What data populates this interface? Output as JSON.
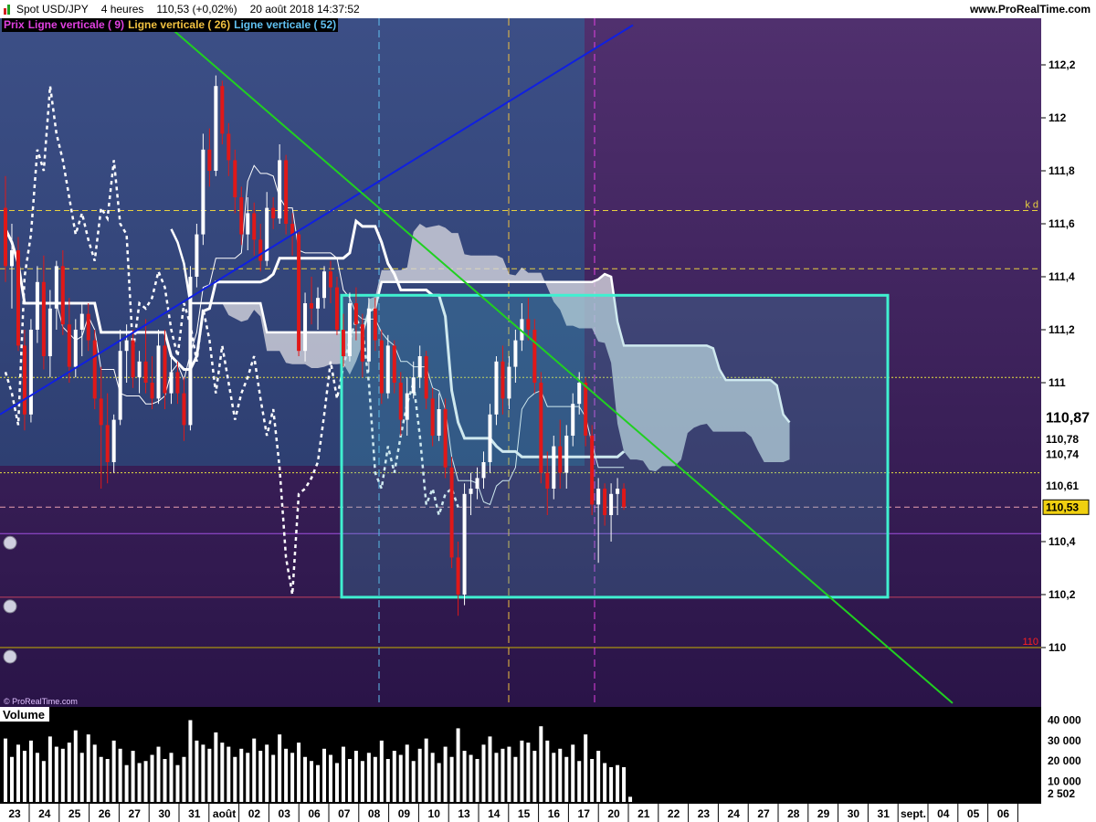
{
  "header": {
    "instrument": "Spot USD/JPY",
    "timeframe": "4 heures",
    "price_change": "110,53 (+0,02%)",
    "datetime": "20 août 2018 14:37:52",
    "site": "www.ProRealTime.com"
  },
  "legend": {
    "price_label": "Prix",
    "items": [
      {
        "label": "Ligne verticale ( 9)",
        "color": "#e040e0"
      },
      {
        "label": "Ligne verticale ( 26)",
        "color": "#f0c040"
      },
      {
        "label": "Ligne verticale ( 52)",
        "color": "#60c0f0"
      }
    ]
  },
  "watermark": "© ProRealTime.com",
  "volume_label": "Volume",
  "chart_data": {
    "type": "candlestick",
    "ylim": [
      109.8,
      112.4
    ],
    "y_ticks": [
      {
        "v": 112.2,
        "label": "112,2"
      },
      {
        "v": 112.0,
        "label": "112"
      },
      {
        "v": 111.8,
        "label": "111,8"
      },
      {
        "v": 111.6,
        "label": "111,6"
      },
      {
        "v": 111.4,
        "label": "111,4"
      },
      {
        "v": 111.2,
        "label": "111,2"
      },
      {
        "v": 111.0,
        "label": "111"
      },
      {
        "v": 110.4,
        "label": "110,4"
      },
      {
        "v": 110.2,
        "label": "110,2"
      },
      {
        "v": 110.0,
        "label": "110"
      }
    ],
    "price_tags": [
      {
        "v": 110.87,
        "label": "110,87",
        "style": "big"
      },
      {
        "v": 110.78,
        "label": "110,78",
        "style": "small"
      },
      {
        "v": 110.74,
        "label": "110,74",
        "style": "small"
      },
      {
        "v": 110.61,
        "label": "110,61",
        "style": "small"
      },
      {
        "v": 110.53,
        "label": "110,53",
        "style": "last"
      }
    ],
    "level_lines": [
      {
        "v": 111.65,
        "color": "#e8d040",
        "dash": "6,4",
        "note": "k d"
      },
      {
        "v": 111.43,
        "color": "#e8d040",
        "dash": "6,4",
        "note": ""
      },
      {
        "v": 111.02,
        "color": "#e8e040",
        "dash": "2,2",
        "note": ""
      },
      {
        "v": 110.66,
        "color": "#e8e040",
        "dash": "2,2",
        "note": ""
      },
      {
        "v": 110.53,
        "color": "#e8a0b0",
        "dash": "6,4",
        "note": ""
      },
      {
        "v": 110.43,
        "color": "#a050e0",
        "dash": "",
        "note": ""
      },
      {
        "v": 110.19,
        "color": "#c04060",
        "dash": "",
        "note": ""
      },
      {
        "v": 110.0,
        "color": "#c8b000",
        "dash": "",
        "note": "110"
      }
    ],
    "x_labels": [
      "23",
      "24",
      "25",
      "26",
      "27",
      "30",
      "31",
      "août",
      "02",
      "03",
      "06",
      "07",
      "08",
      "09",
      "10",
      "13",
      "14",
      "15",
      "16",
      "17",
      "20",
      "21",
      "22",
      "23",
      "24",
      "27",
      "28",
      "29",
      "30",
      "31",
      "sept.",
      "04",
      "05",
      "06"
    ],
    "volume_ticks": [
      {
        "v": 40000,
        "label": "40 000"
      },
      {
        "v": 30000,
        "label": "30 000"
      },
      {
        "v": 20000,
        "label": "20 000"
      },
      {
        "v": 10000,
        "label": "10 000"
      }
    ],
    "volume_last": "2 502",
    "volume_max": 42000,
    "candles": [
      {
        "o": 111.66,
        "h": 111.78,
        "l": 111.38,
        "c": 111.44
      },
      {
        "o": 111.44,
        "h": 111.6,
        "l": 111.28,
        "c": 111.5
      },
      {
        "o": 111.5,
        "h": 111.55,
        "l": 111.12,
        "c": 111.14
      },
      {
        "o": 111.14,
        "h": 111.2,
        "l": 110.82,
        "c": 110.88
      },
      {
        "o": 110.88,
        "h": 111.24,
        "l": 110.85,
        "c": 111.2
      },
      {
        "o": 111.2,
        "h": 111.44,
        "l": 111.15,
        "c": 111.38
      },
      {
        "o": 111.38,
        "h": 111.48,
        "l": 111.05,
        "c": 111.1
      },
      {
        "o": 111.1,
        "h": 111.35,
        "l": 111.02,
        "c": 111.28
      },
      {
        "o": 111.28,
        "h": 111.46,
        "l": 111.2,
        "c": 111.44
      },
      {
        "o": 111.44,
        "h": 111.5,
        "l": 111.18,
        "c": 111.22
      },
      {
        "o": 111.22,
        "h": 111.32,
        "l": 111.0,
        "c": 111.06
      },
      {
        "o": 111.06,
        "h": 111.24,
        "l": 111.02,
        "c": 111.2
      },
      {
        "o": 111.2,
        "h": 111.3,
        "l": 111.1,
        "c": 111.26
      },
      {
        "o": 111.26,
        "h": 111.3,
        "l": 111.12,
        "c": 111.16
      },
      {
        "o": 111.16,
        "h": 111.2,
        "l": 110.9,
        "c": 110.94
      },
      {
        "o": 110.94,
        "h": 111.06,
        "l": 110.6,
        "c": 110.84
      },
      {
        "o": 110.84,
        "h": 110.96,
        "l": 110.62,
        "c": 110.7
      },
      {
        "o": 110.7,
        "h": 110.88,
        "l": 110.66,
        "c": 110.86
      },
      {
        "o": 110.86,
        "h": 111.2,
        "l": 110.84,
        "c": 111.12
      },
      {
        "o": 111.12,
        "h": 111.22,
        "l": 111.0,
        "c": 111.16
      },
      {
        "o": 111.16,
        "h": 111.2,
        "l": 110.98,
        "c": 111.02
      },
      {
        "o": 111.02,
        "h": 111.12,
        "l": 110.96,
        "c": 111.08
      },
      {
        "o": 111.08,
        "h": 111.24,
        "l": 110.96,
        "c": 111.0
      },
      {
        "o": 111.0,
        "h": 111.1,
        "l": 110.9,
        "c": 110.94
      },
      {
        "o": 110.94,
        "h": 111.2,
        "l": 110.92,
        "c": 111.14
      },
      {
        "o": 111.14,
        "h": 111.2,
        "l": 110.9,
        "c": 110.96
      },
      {
        "o": 110.96,
        "h": 111.1,
        "l": 110.92,
        "c": 111.04
      },
      {
        "o": 111.04,
        "h": 111.08,
        "l": 110.92,
        "c": 110.96
      },
      {
        "o": 110.96,
        "h": 111.02,
        "l": 110.78,
        "c": 110.84
      },
      {
        "o": 110.84,
        "h": 111.44,
        "l": 110.82,
        "c": 111.4
      },
      {
        "o": 111.4,
        "h": 111.6,
        "l": 111.36,
        "c": 111.56
      },
      {
        "o": 111.56,
        "h": 111.94,
        "l": 111.52,
        "c": 111.88
      },
      {
        "o": 111.88,
        "h": 111.96,
        "l": 111.74,
        "c": 111.8
      },
      {
        "o": 111.8,
        "h": 112.16,
        "l": 111.78,
        "c": 112.12
      },
      {
        "o": 112.12,
        "h": 112.14,
        "l": 111.9,
        "c": 111.94
      },
      {
        "o": 111.94,
        "h": 111.98,
        "l": 111.78,
        "c": 111.84
      },
      {
        "o": 111.84,
        "h": 111.88,
        "l": 111.64,
        "c": 111.7
      },
      {
        "o": 111.7,
        "h": 111.74,
        "l": 111.52,
        "c": 111.56
      },
      {
        "o": 111.56,
        "h": 111.7,
        "l": 111.5,
        "c": 111.64
      },
      {
        "o": 111.64,
        "h": 111.68,
        "l": 111.48,
        "c": 111.54
      },
      {
        "o": 111.54,
        "h": 111.6,
        "l": 111.42,
        "c": 111.46
      },
      {
        "o": 111.46,
        "h": 111.72,
        "l": 111.44,
        "c": 111.66
      },
      {
        "o": 111.66,
        "h": 111.7,
        "l": 111.58,
        "c": 111.62
      },
      {
        "o": 111.62,
        "h": 111.9,
        "l": 111.6,
        "c": 111.84
      },
      {
        "o": 111.84,
        "h": 111.86,
        "l": 111.56,
        "c": 111.6
      },
      {
        "o": 111.6,
        "h": 111.64,
        "l": 111.48,
        "c": 111.56
      },
      {
        "o": 111.56,
        "h": 111.58,
        "l": 111.1,
        "c": 111.12
      },
      {
        "o": 111.12,
        "h": 111.34,
        "l": 111.08,
        "c": 111.3
      },
      {
        "o": 111.3,
        "h": 111.4,
        "l": 111.22,
        "c": 111.28
      },
      {
        "o": 111.28,
        "h": 111.36,
        "l": 111.2,
        "c": 111.32
      },
      {
        "o": 111.32,
        "h": 111.44,
        "l": 111.28,
        "c": 111.42
      },
      {
        "o": 111.42,
        "h": 111.46,
        "l": 111.3,
        "c": 111.36
      },
      {
        "o": 111.36,
        "h": 111.4,
        "l": 111.18,
        "c": 111.2
      },
      {
        "o": 111.2,
        "h": 111.26,
        "l": 111.06,
        "c": 111.1
      },
      {
        "o": 111.1,
        "h": 111.34,
        "l": 111.08,
        "c": 111.3
      },
      {
        "o": 111.3,
        "h": 111.36,
        "l": 111.16,
        "c": 111.22
      },
      {
        "o": 111.22,
        "h": 111.26,
        "l": 111.02,
        "c": 111.08
      },
      {
        "o": 111.08,
        "h": 111.32,
        "l": 111.04,
        "c": 111.28
      },
      {
        "o": 111.28,
        "h": 111.32,
        "l": 111.12,
        "c": 111.16
      },
      {
        "o": 111.16,
        "h": 111.2,
        "l": 110.92,
        "c": 110.96
      },
      {
        "o": 110.96,
        "h": 111.18,
        "l": 110.94,
        "c": 111.14
      },
      {
        "o": 111.14,
        "h": 111.16,
        "l": 110.96,
        "c": 111.0
      },
      {
        "o": 111.0,
        "h": 111.04,
        "l": 110.8,
        "c": 110.86
      },
      {
        "o": 110.86,
        "h": 111.02,
        "l": 110.8,
        "c": 110.96
      },
      {
        "o": 110.96,
        "h": 111.08,
        "l": 110.94,
        "c": 111.02
      },
      {
        "o": 111.02,
        "h": 111.14,
        "l": 110.98,
        "c": 111.1
      },
      {
        "o": 111.1,
        "h": 111.12,
        "l": 110.9,
        "c": 110.94
      },
      {
        "o": 110.94,
        "h": 110.98,
        "l": 110.76,
        "c": 110.8
      },
      {
        "o": 110.8,
        "h": 110.96,
        "l": 110.78,
        "c": 110.9
      },
      {
        "o": 110.9,
        "h": 110.94,
        "l": 110.64,
        "c": 110.68
      },
      {
        "o": 110.68,
        "h": 110.72,
        "l": 110.3,
        "c": 110.34
      },
      {
        "o": 110.34,
        "h": 110.4,
        "l": 110.12,
        "c": 110.2
      },
      {
        "o": 110.2,
        "h": 110.62,
        "l": 110.16,
        "c": 110.58
      },
      {
        "o": 110.58,
        "h": 110.66,
        "l": 110.5,
        "c": 110.6
      },
      {
        "o": 110.6,
        "h": 110.68,
        "l": 110.56,
        "c": 110.64
      },
      {
        "o": 110.64,
        "h": 110.74,
        "l": 110.6,
        "c": 110.7
      },
      {
        "o": 110.7,
        "h": 110.92,
        "l": 110.66,
        "c": 110.88
      },
      {
        "o": 110.88,
        "h": 111.1,
        "l": 110.84,
        "c": 111.08
      },
      {
        "o": 111.08,
        "h": 111.14,
        "l": 110.88,
        "c": 110.94
      },
      {
        "o": 110.94,
        "h": 111.1,
        "l": 110.9,
        "c": 111.06
      },
      {
        "o": 111.06,
        "h": 111.2,
        "l": 111.0,
        "c": 111.16
      },
      {
        "o": 111.16,
        "h": 111.3,
        "l": 111.12,
        "c": 111.24
      },
      {
        "o": 111.24,
        "h": 111.32,
        "l": 111.16,
        "c": 111.2
      },
      {
        "o": 111.2,
        "h": 111.24,
        "l": 110.96,
        "c": 111.0
      },
      {
        "o": 111.0,
        "h": 111.04,
        "l": 110.62,
        "c": 110.66
      },
      {
        "o": 110.66,
        "h": 110.74,
        "l": 110.5,
        "c": 110.6
      },
      {
        "o": 110.6,
        "h": 110.8,
        "l": 110.56,
        "c": 110.76
      },
      {
        "o": 110.76,
        "h": 110.86,
        "l": 110.6,
        "c": 110.66
      },
      {
        "o": 110.66,
        "h": 110.84,
        "l": 110.6,
        "c": 110.8
      },
      {
        "o": 110.8,
        "h": 110.96,
        "l": 110.76,
        "c": 110.92
      },
      {
        "o": 110.92,
        "h": 111.04,
        "l": 110.88,
        "c": 111.0
      },
      {
        "o": 111.0,
        "h": 111.02,
        "l": 110.76,
        "c": 110.8
      },
      {
        "o": 110.8,
        "h": 110.84,
        "l": 110.5,
        "c": 110.54
      },
      {
        "o": 110.54,
        "h": 110.64,
        "l": 110.32,
        "c": 110.6
      },
      {
        "o": 110.6,
        "h": 110.62,
        "l": 110.46,
        "c": 110.5
      },
      {
        "o": 110.5,
        "h": 110.62,
        "l": 110.4,
        "c": 110.58
      },
      {
        "o": 110.58,
        "h": 110.64,
        "l": 110.5,
        "c": 110.6
      },
      {
        "o": 110.6,
        "h": 110.62,
        "l": 110.52,
        "c": 110.53
      }
    ],
    "volumes": [
      31000,
      22000,
      28000,
      25000,
      30000,
      24000,
      20000,
      32000,
      27000,
      26000,
      29000,
      35000,
      24000,
      33000,
      28000,
      22000,
      21000,
      30000,
      26000,
      18000,
      25000,
      19000,
      20000,
      23000,
      27000,
      21000,
      24000,
      18000,
      22000,
      40000,
      30000,
      28000,
      26000,
      34000,
      29000,
      27000,
      22000,
      26000,
      24000,
      31000,
      25000,
      28000,
      23000,
      33000,
      26000,
      24000,
      29000,
      22000,
      20000,
      18000,
      26000,
      23000,
      19000,
      27000,
      21000,
      25000,
      20000,
      24000,
      22000,
      30000,
      21000,
      25000,
      23000,
      28000,
      20000,
      26000,
      31000,
      24000,
      19000,
      27000,
      22000,
      36000,
      25000,
      23000,
      21000,
      28000,
      32000,
      24000,
      26000,
      27000,
      22000,
      30000,
      29000,
      25000,
      37000,
      30000,
      24000,
      26000,
      22000,
      28000,
      20000,
      33000,
      21000,
      25000,
      19000,
      17000,
      18000,
      17000,
      2502
    ]
  }
}
